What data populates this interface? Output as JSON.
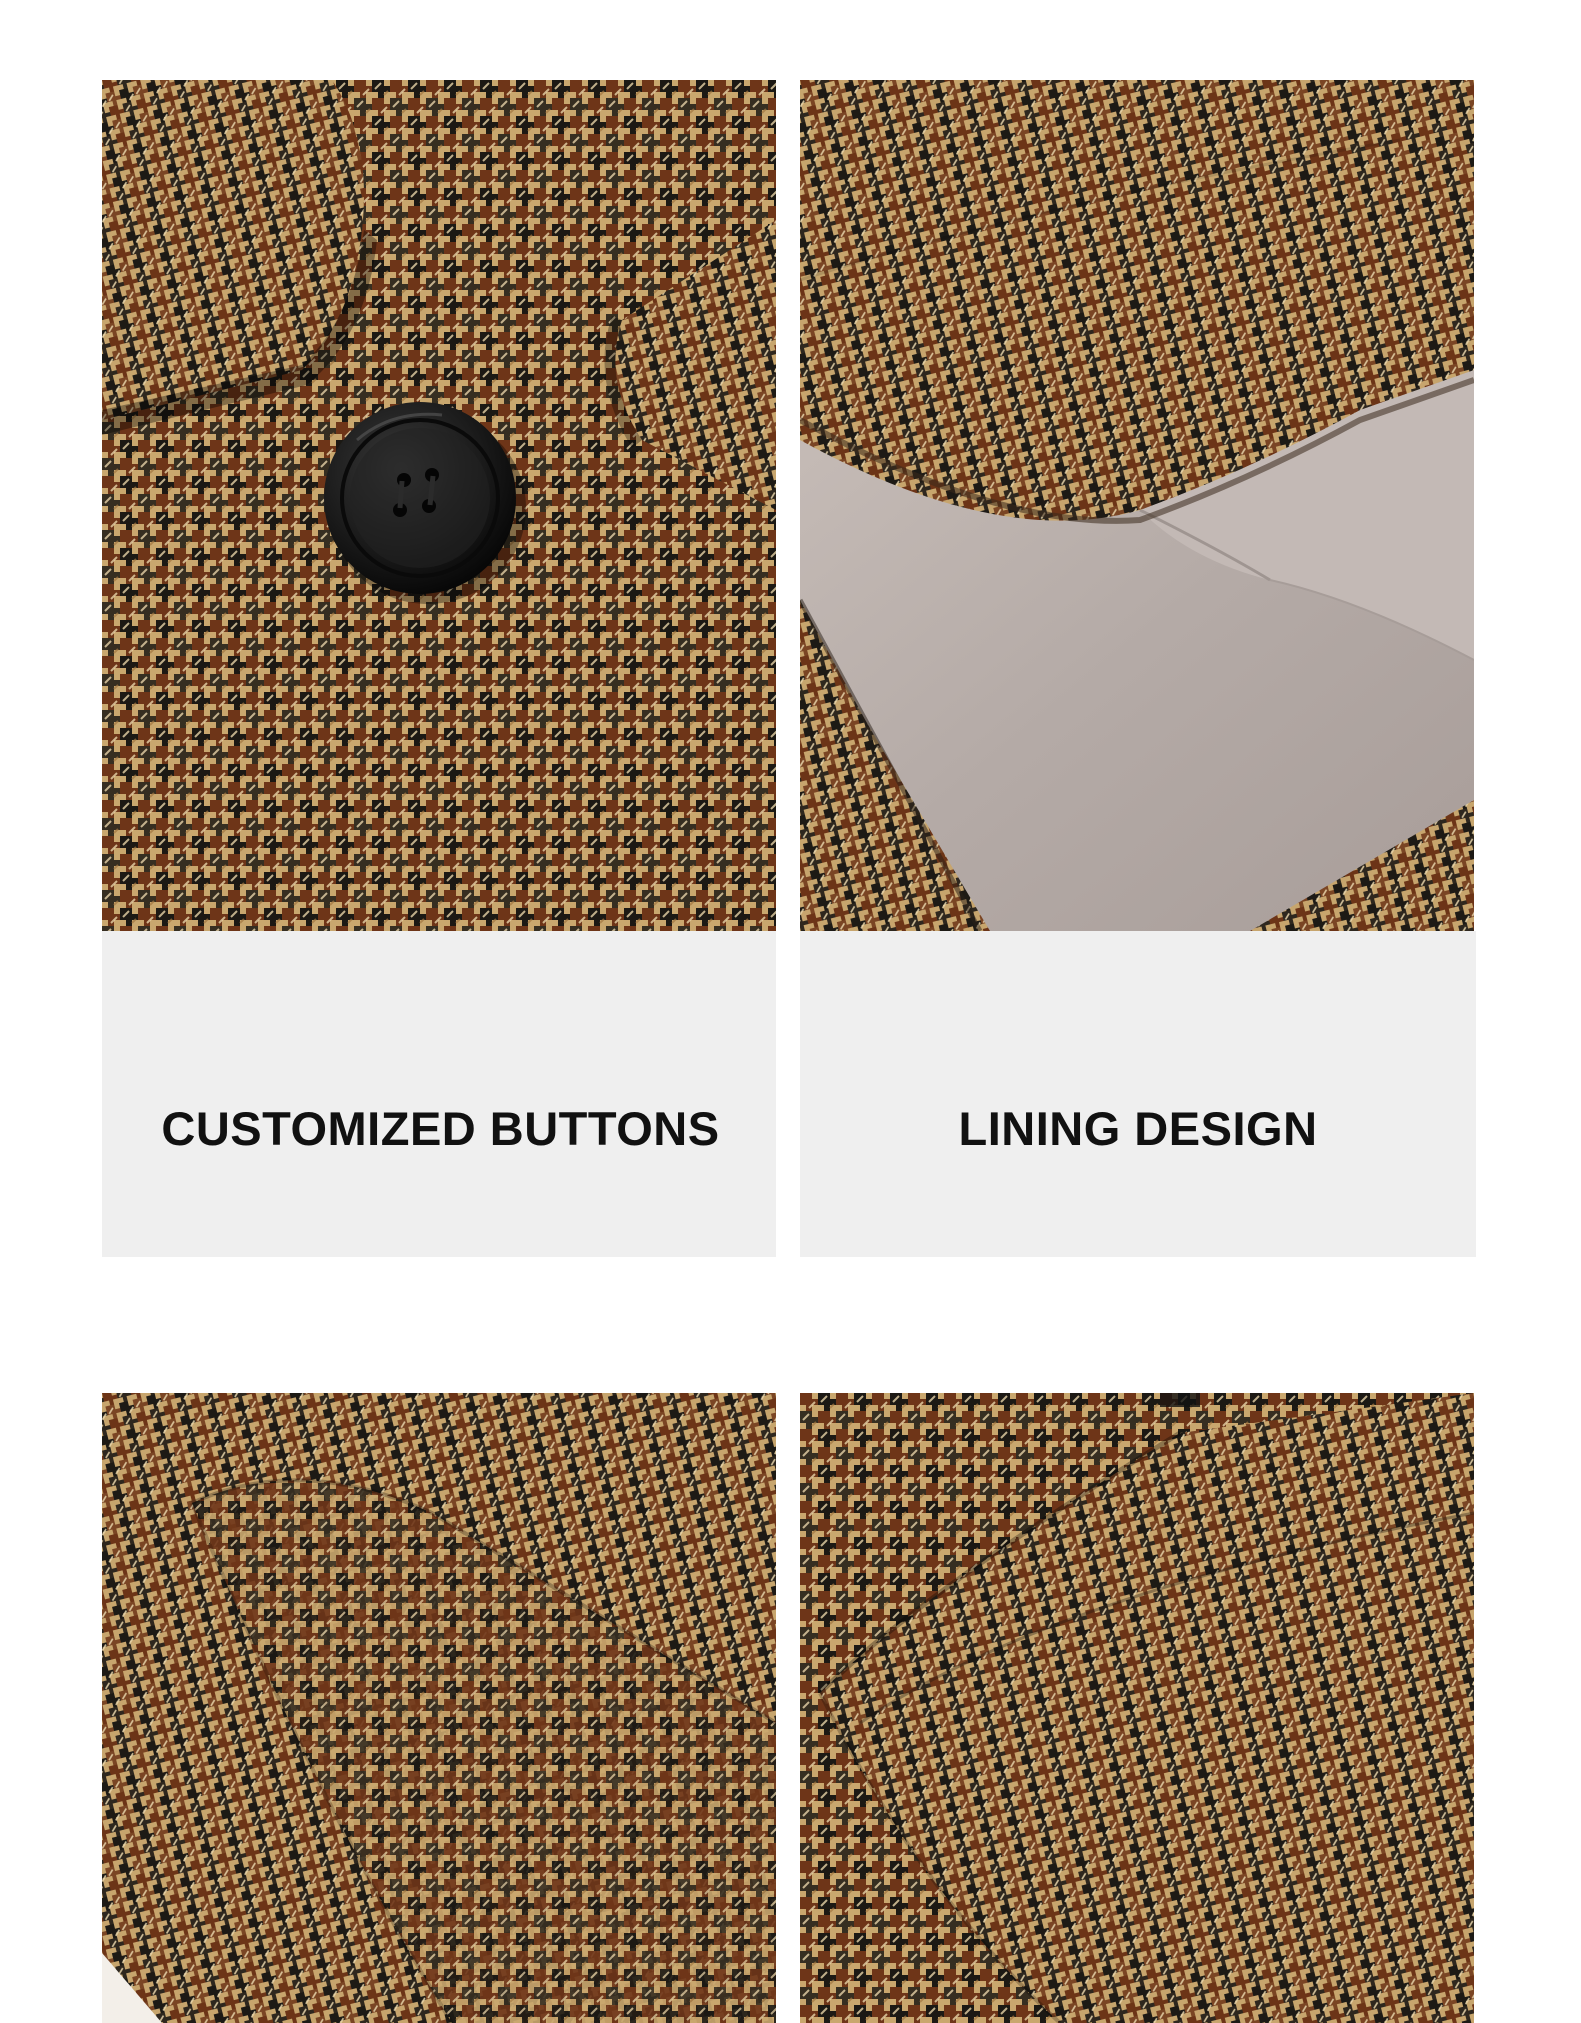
{
  "panels": [
    {
      "caption": "CUSTOMIZED BUTTONS"
    },
    {
      "caption": "LINING DESIGN"
    }
  ],
  "colors": {
    "background": "#ffffff",
    "caption_box": "#efefef",
    "caption_text": "#111111",
    "houndstooth_base": "#c9a76e",
    "houndstooth_brown": "#6e3518",
    "houndstooth_dark": "#1c1914",
    "lining": "#b9aeaa",
    "button": "#1a1a1a"
  }
}
